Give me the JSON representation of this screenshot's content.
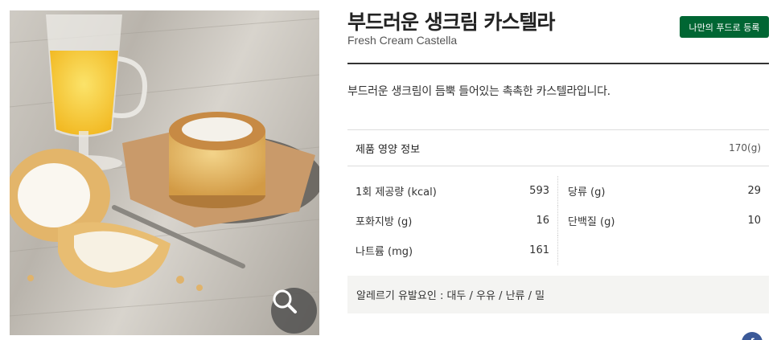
{
  "product": {
    "name_ko": "부드러운 생크림 카스텔라",
    "name_en": "Fresh Cream Castella",
    "description": "부드러운 생크림이 듬뿍 들어있는 촉촉한 카스텔라입니다.",
    "add_button_label": "나만의 푸드로 등록"
  },
  "nutrition": {
    "header_label": "제품 영양 정보",
    "weight": "170(g)",
    "rows": [
      [
        {
          "label": "1회 제공량 (kcal)",
          "value": "593"
        },
        {
          "label": "당류 (g)",
          "value": "29"
        }
      ],
      [
        {
          "label": "포화지방 (g)",
          "value": "16"
        },
        {
          "label": "단백질 (g)",
          "value": "10"
        }
      ],
      [
        {
          "label": "나트륨 (mg)",
          "value": "161"
        }
      ]
    ],
    "allergy": "알레르기 유발요인 : 대두 / 우유 / 난류 / 밀"
  },
  "icons": {
    "zoom": "magnifier-icon",
    "share": "facebook-icon"
  },
  "colors": {
    "brand_green": "#006633",
    "facebook_blue": "#3b5998"
  }
}
